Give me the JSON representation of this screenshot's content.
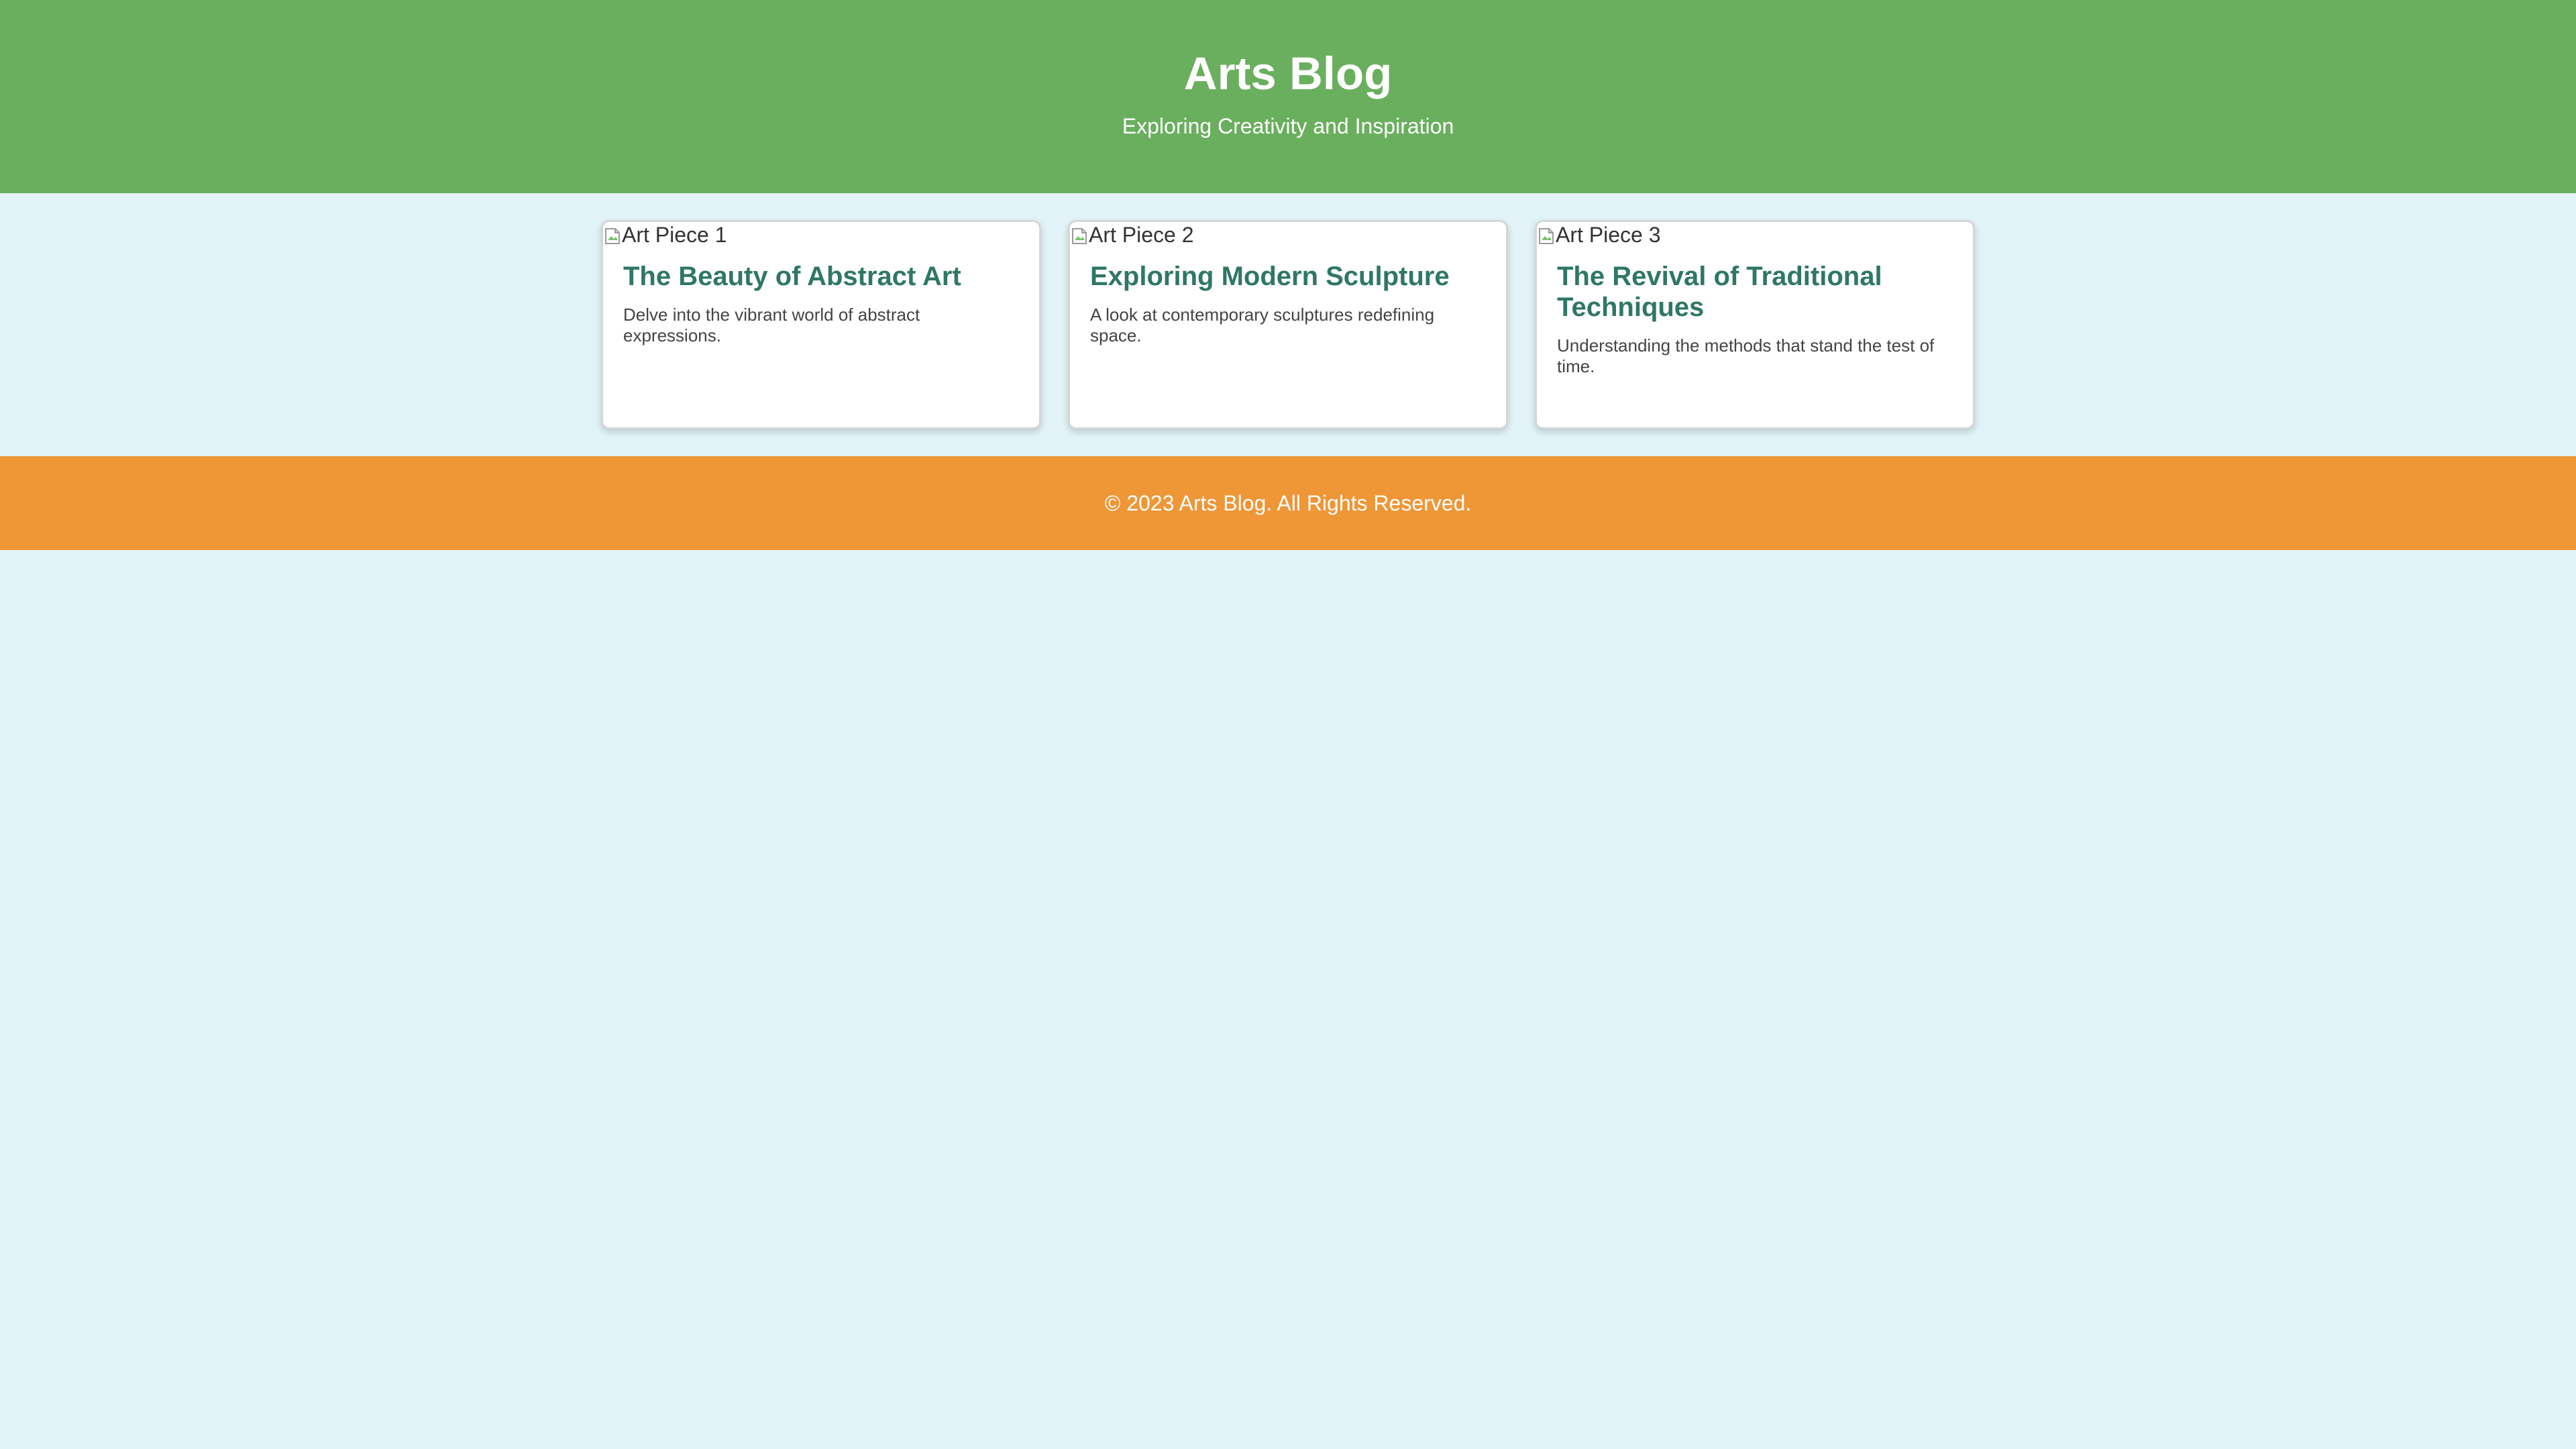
{
  "header": {
    "title": "Arts Blog",
    "tagline": "Exploring Creativity and Inspiration"
  },
  "posts": [
    {
      "image_alt": "Art Piece 1",
      "title": "The Beauty of Abstract Art",
      "excerpt": "Delve into the vibrant world of abstract expressions."
    },
    {
      "image_alt": "Art Piece 2",
      "title": "Exploring Modern Sculpture",
      "excerpt": "A look at contemporary sculptures redefining space."
    },
    {
      "image_alt": "Art Piece 3",
      "title": "The Revival of Traditional Techniques",
      "excerpt": "Understanding the methods that stand the test of time."
    }
  ],
  "footer": {
    "text": "© 2023 Arts Blog. All Rights Reserved."
  },
  "colors": {
    "header_background": "#6aaf5e",
    "page_background": "#e2f4f8",
    "post_title": "#2f7766",
    "footer_background": "#ef9637"
  },
  "icons": {
    "post_image": "broken-image-icon"
  }
}
